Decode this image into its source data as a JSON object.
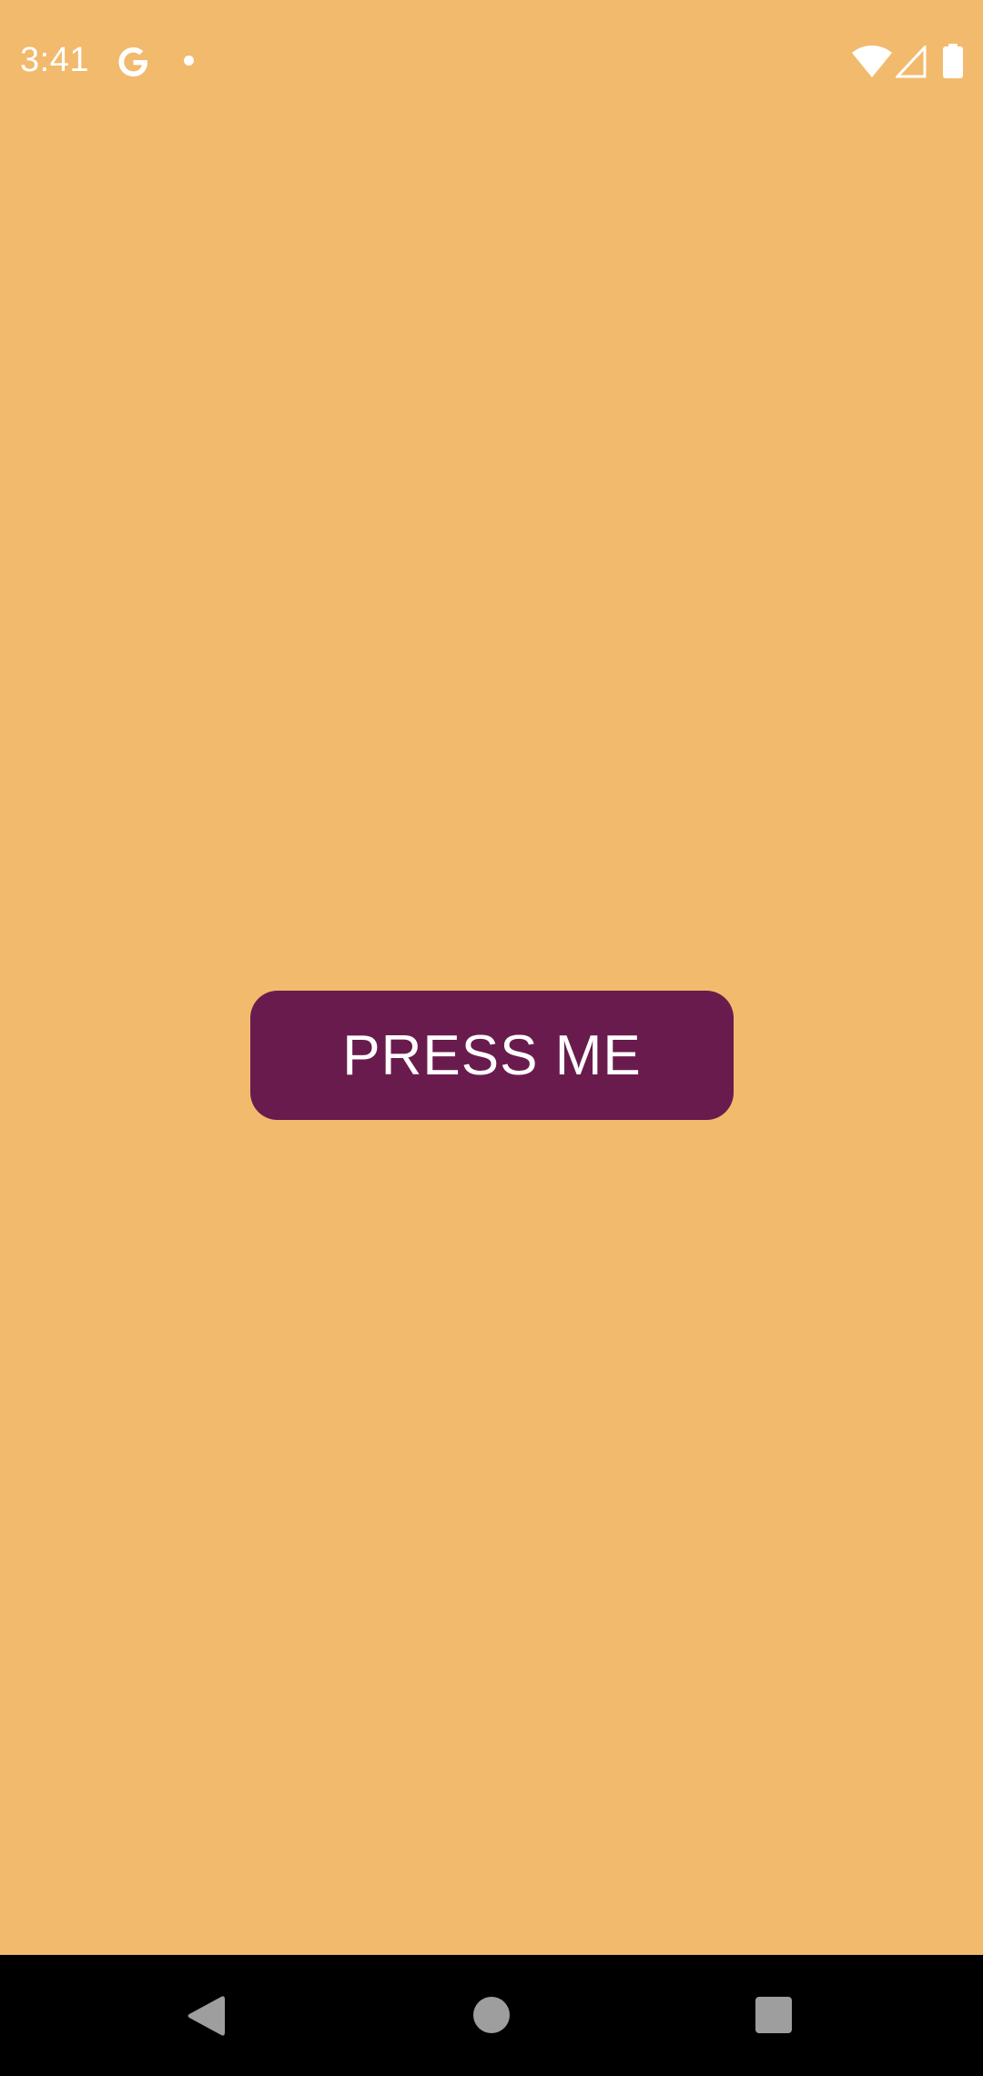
{
  "status_bar": {
    "time": "3:41",
    "icons": [
      "google-g-icon",
      "notification-dot-icon",
      "wifi-icon",
      "cell-signal-icon",
      "battery-icon"
    ]
  },
  "main": {
    "button_label": "PRESS ME"
  },
  "nav_bar": {
    "icons": [
      "back-icon",
      "home-icon",
      "recents-icon"
    ]
  },
  "colors": {
    "background": "#F2BA6C",
    "button": "#6A1B4D",
    "button_text": "#FFFFFF",
    "nav_bar": "#000000",
    "nav_icons": "#9E9E9E"
  }
}
